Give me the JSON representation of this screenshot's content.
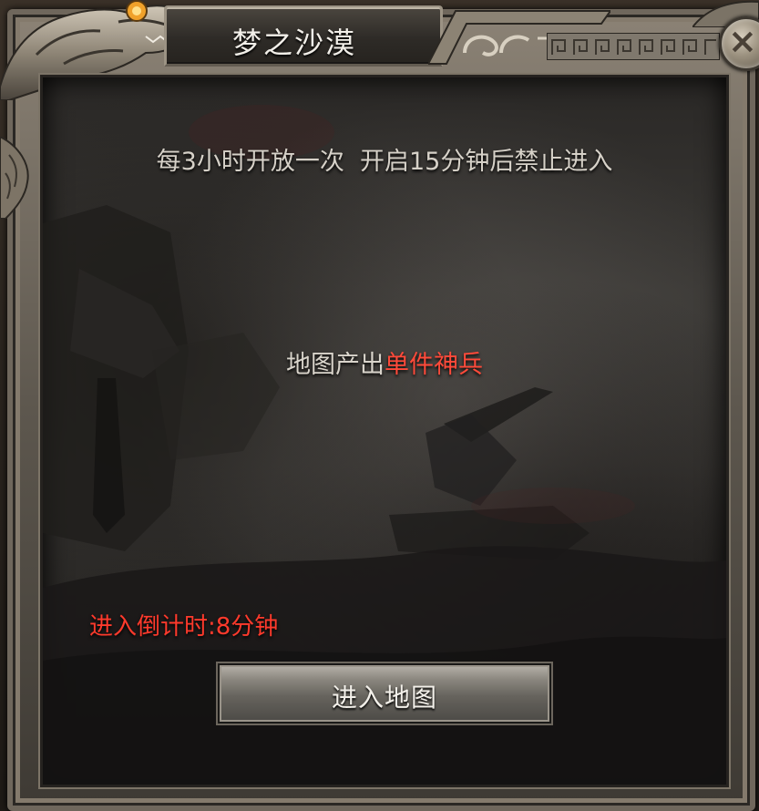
{
  "dialog": {
    "title": "梦之沙漠"
  },
  "info": {
    "schedule": "每3小时开放一次  开启15分钟后禁止进入",
    "drop_label": "地图产出",
    "drop_item": "单件神兵",
    "countdown": "进入倒计时:8分钟"
  },
  "actions": {
    "enter_label": "进入地图",
    "close_symbol": "×"
  },
  "icons": {
    "close": "close-icon",
    "dragon": "dragon-ornament-icon",
    "scroll": "scroll-ornament-icon"
  },
  "colors": {
    "highlight_red": "#ff4a3a",
    "text_light": "#d6d1c8",
    "frame_stone": "#6f675c"
  }
}
